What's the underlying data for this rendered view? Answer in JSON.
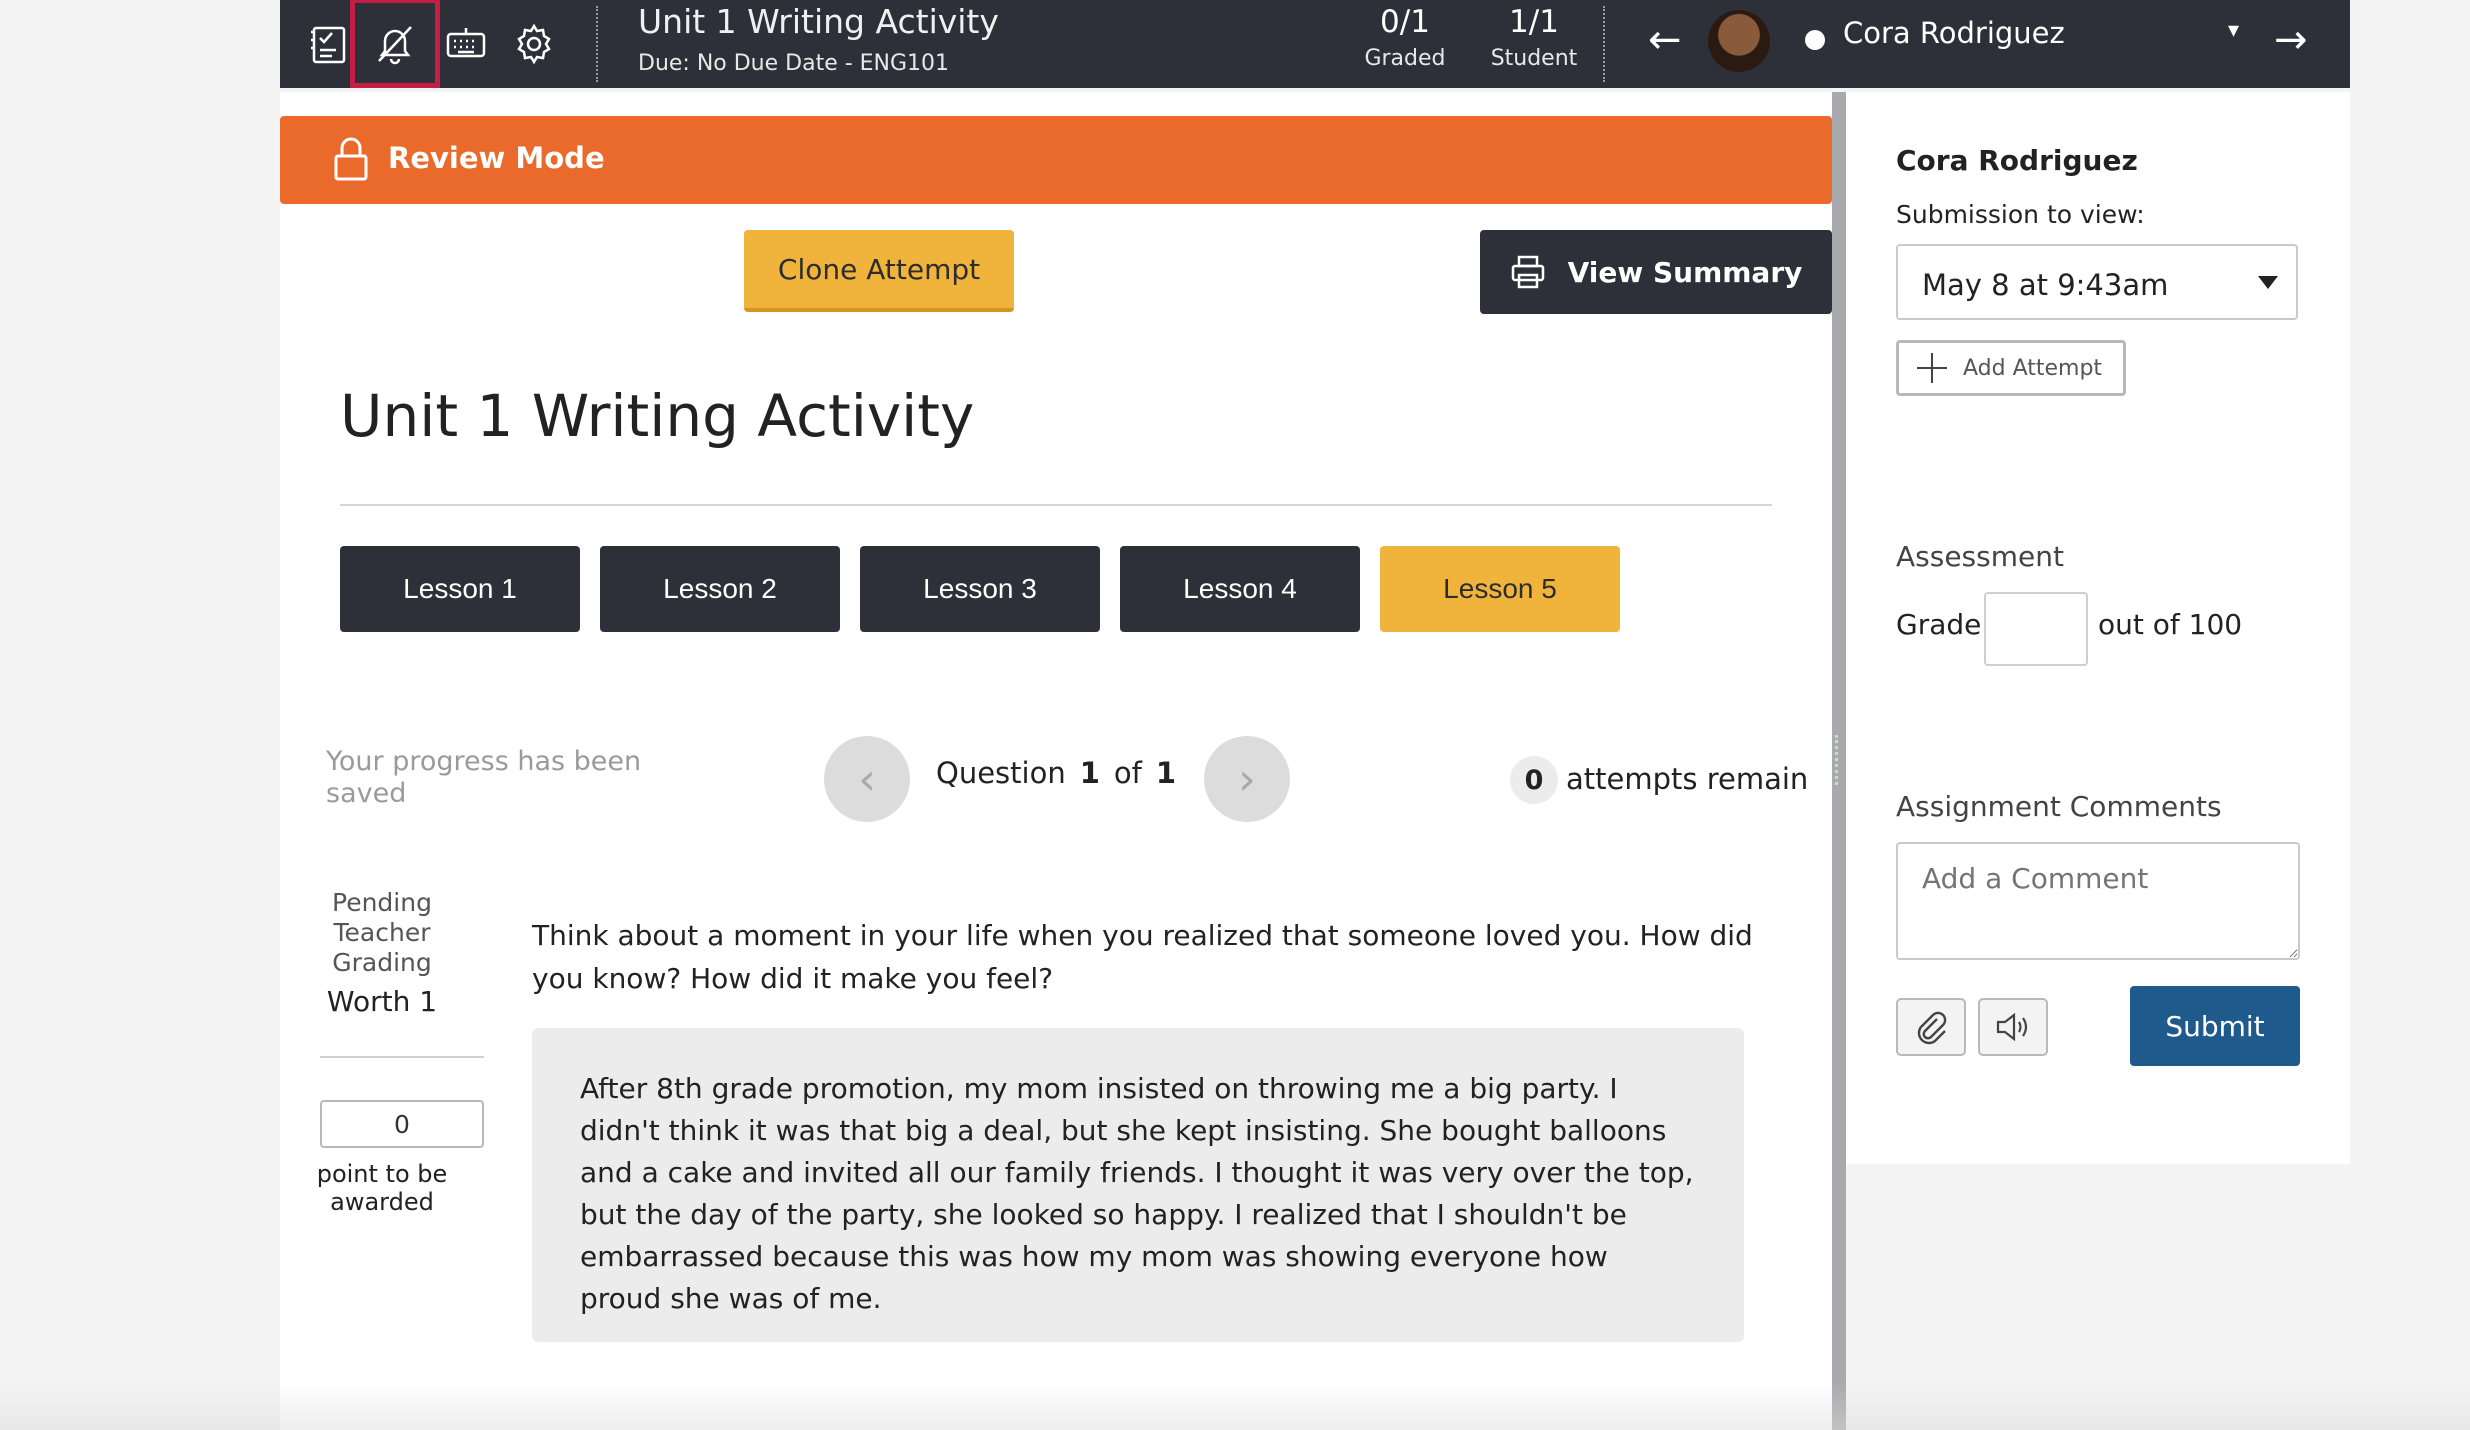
{
  "topbar": {
    "title": "Unit 1 Writing Activity",
    "due": "Due: No Due Date - ENG101",
    "graded_value": "0/1",
    "graded_label": "Graded",
    "student_value": "1/1",
    "student_label": "Student",
    "student_name": "Cora Rodriguez",
    "prev_arrow": "←",
    "next_arrow": "→",
    "dropdown_caret": "▾",
    "icons": [
      "checklist-icon",
      "bell-off-icon",
      "keyboard-icon",
      "gear-icon"
    ],
    "selected_icon_color": "#c41e44",
    "background_color": "#2d3038"
  },
  "banner": {
    "label": "Review Mode",
    "color": "#ea6a2c"
  },
  "actions": {
    "clone_label": "Clone Attempt",
    "summary_label": "View Summary"
  },
  "activity": {
    "title": "Unit 1 Writing Activity",
    "lessons": [
      {
        "label": "Lesson 1",
        "active": false
      },
      {
        "label": "Lesson 2",
        "active": false
      },
      {
        "label": "Lesson 3",
        "active": false
      },
      {
        "label": "Lesson 4",
        "active": false
      },
      {
        "label": "Lesson 5",
        "active": true
      }
    ]
  },
  "question": {
    "saved_text": "Your progress has been saved",
    "label": "Question",
    "current": "1",
    "of_label": "of",
    "total": "1",
    "attempts_count": "0",
    "attempts_label": "attempts remain",
    "pending_status": "Pending Teacher Grading",
    "worth": "Worth 1",
    "points_value": "0",
    "points_label": "point to be awarded",
    "prompt": "Think about a moment in your life when you realized that someone loved you. How did you know? How did it make you feel?",
    "answer": "After 8th grade promotion, my mom insisted on throwing me a big party. I didn't think it was that big a deal, but she kept insisting. She bought balloons and a cake and invited all our family friends. I thought it was very over the top, but the day of the party, she looked so happy. I realized that I shouldn't be embarrassed because this was how my mom was showing everyone how proud she was of me."
  },
  "side_panel": {
    "student_name": "Cora Rodriguez",
    "submission_label": "Submission to view:",
    "submission_selected": "May 8 at 9:43am",
    "add_attempt_label": "Add Attempt",
    "assessment_heading": "Assessment",
    "grade_label": "Grade",
    "grade_value": "",
    "grade_out_of": "out of 100",
    "comments_heading": "Assignment Comments",
    "comment_placeholder": "Add a Comment",
    "submit_label": "Submit",
    "submit_color": "#1f5a8c"
  }
}
